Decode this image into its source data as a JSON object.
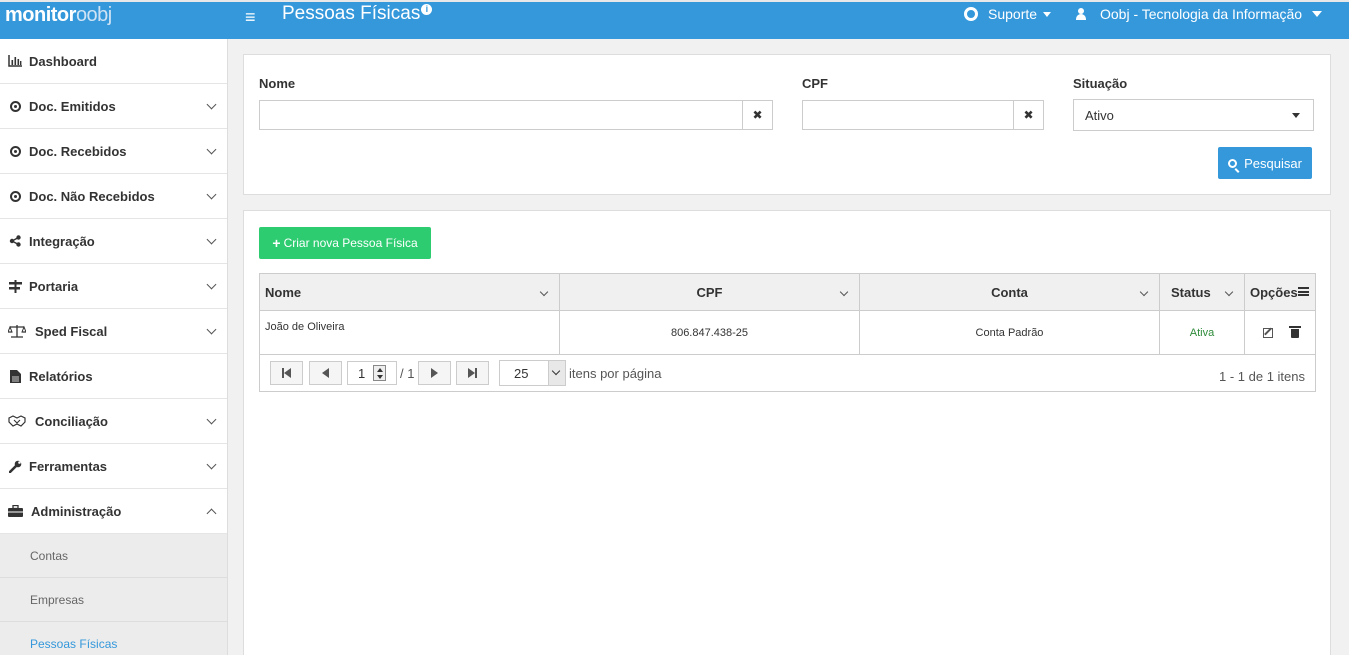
{
  "topbar": {
    "logo_main": "monitor",
    "logo_accent": "oobj",
    "title": "Pessoas Físicas",
    "info_glyph": "i",
    "support_label": "Suporte",
    "user_label": "Oobj - Tecnologia da Informação"
  },
  "sidebar": {
    "items": [
      {
        "label": "Dashboard"
      },
      {
        "label": "Doc. Emitidos"
      },
      {
        "label": "Doc. Recebidos"
      },
      {
        "label": "Doc. Não Recebidos"
      },
      {
        "label": "Integração"
      },
      {
        "label": "Portaria"
      },
      {
        "label": "Sped Fiscal"
      },
      {
        "label": "Relatórios"
      },
      {
        "label": "Conciliação"
      },
      {
        "label": "Ferramentas"
      },
      {
        "label": "Administração"
      }
    ],
    "subitems": [
      {
        "label": "Contas"
      },
      {
        "label": "Empresas"
      },
      {
        "label": "Pessoas Físicas"
      }
    ]
  },
  "filter": {
    "nome_label": "Nome",
    "nome_value": "",
    "cpf_label": "CPF",
    "cpf_value": "",
    "situacao_label": "Situação",
    "situacao_value": "Ativo",
    "clear_glyph": "✖",
    "search_label": "Pesquisar"
  },
  "results": {
    "create_label": "Criar nova Pessoa Física",
    "create_plus": "+",
    "columns": [
      "Nome",
      "CPF",
      "Conta",
      "Status",
      "Opções"
    ],
    "rows": [
      {
        "nome": "João de Oliveira",
        "cpf": "806.847.438-25",
        "conta": "Conta Padrão",
        "status": "Ativa"
      }
    ],
    "pager": {
      "current_page": "1",
      "of_pages": "/ 1",
      "per_page": "25",
      "per_page_label": "itens por página",
      "count": "1 - 1 de 1 itens"
    }
  },
  "colors": {
    "primary": "#3498db",
    "success": "#2ecc71",
    "status_active": "#2e8b3a"
  }
}
